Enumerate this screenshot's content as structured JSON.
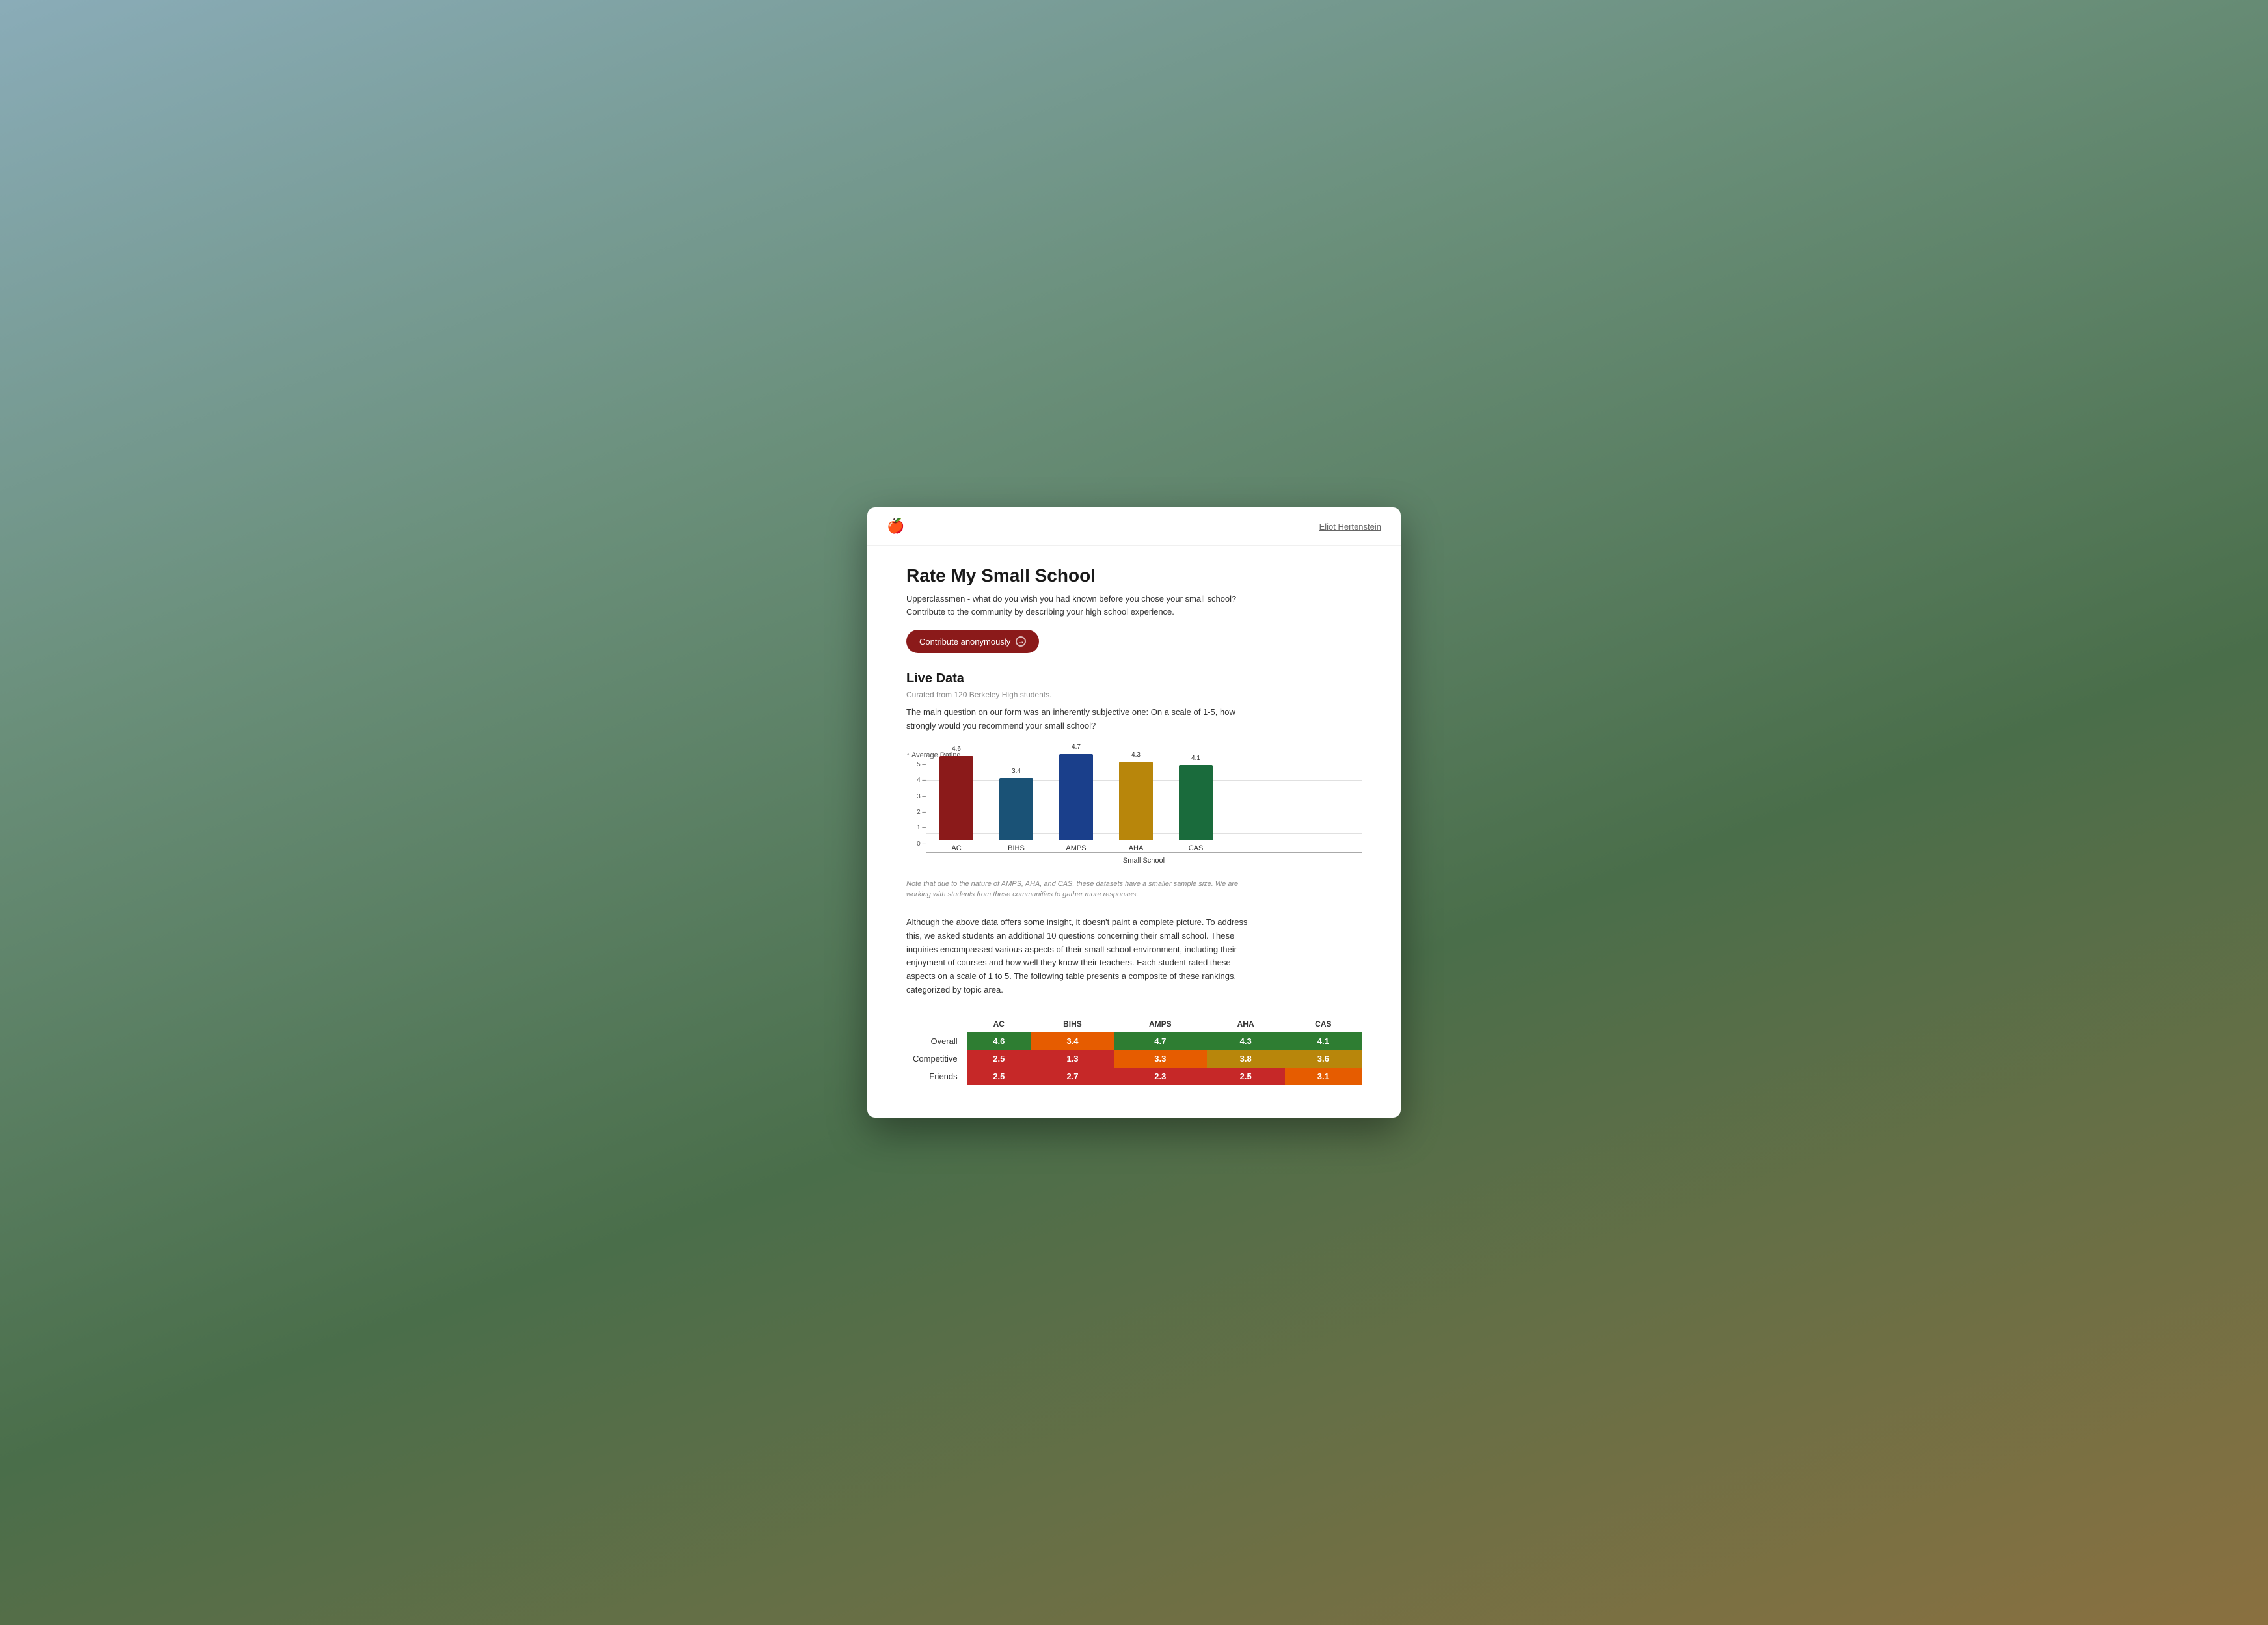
{
  "header": {
    "logo": "🍎",
    "user_name": "Eliot Hertenstein"
  },
  "page": {
    "title": "Rate My Small School",
    "subtitle": "Upperclassmen - what do you wish you had known before you chose your small school? Contribute to the community by describing your high school experience.",
    "contribute_button": "Contribute anonymously",
    "live_data_title": "Live Data",
    "curated_text": "Curated from 120 Berkeley High students.",
    "description": "The main question on our form was an inherently subjective one: On a scale of 1-5, how strongly would you recommend your small school?",
    "chart_y_label": "↑ Average Rating",
    "x_axis_label": "Small School",
    "footnote": "Note that due to the nature of AMPS, AHA, and CAS, these datasets have a smaller sample size. We are working with students from these communities to gather more responses.",
    "body_text": "Although the above data offers some insight, it doesn't paint a complete picture. To address this, we asked students an additional 10 questions concerning their small school. These inquiries encompassed various aspects of their small school environment, including their enjoyment of courses and how well they know their teachers. Each student rated these aspects on a scale of 1 to 5. The following table presents a composite of these rankings, categorized by topic area."
  },
  "chart": {
    "y_ticks": [
      "0 –",
      "1 –",
      "2 –",
      "3 –",
      "4 –",
      "5 –"
    ],
    "bars": [
      {
        "label": "AC",
        "value": 4.6,
        "color": "#8b1a1a",
        "height_pct": 92
      },
      {
        "label": "BIHS",
        "value": 3.4,
        "color": "#1a5276",
        "height_pct": 68
      },
      {
        "label": "AMPS",
        "value": 4.7,
        "color": "#1a3f8b",
        "height_pct": 94
      },
      {
        "label": "AHA",
        "value": 4.3,
        "color": "#b8860b",
        "height_pct": 86
      },
      {
        "label": "CAS",
        "value": 4.1,
        "color": "#1a6b3c",
        "height_pct": 82
      }
    ]
  },
  "table": {
    "columns": [
      "",
      "AC",
      "BIHS",
      "AMPS",
      "AHA",
      "CAS"
    ],
    "rows": [
      {
        "label": "Overall",
        "values": [
          "4.6",
          "3.4",
          "4.7",
          "4.3",
          "4.1"
        ],
        "colors": [
          "green",
          "orange",
          "green",
          "green",
          "green"
        ]
      },
      {
        "label": "Competitive",
        "values": [
          "2.5",
          "1.3",
          "3.3",
          "3.8",
          "3.6"
        ],
        "colors": [
          "red",
          "red",
          "orange",
          "amber",
          "amber"
        ]
      },
      {
        "label": "Friends",
        "values": [
          "2.5",
          "2.7",
          "2.3",
          "2.5",
          "3.1"
        ],
        "colors": [
          "red",
          "red",
          "red",
          "red",
          "orange"
        ]
      }
    ]
  }
}
